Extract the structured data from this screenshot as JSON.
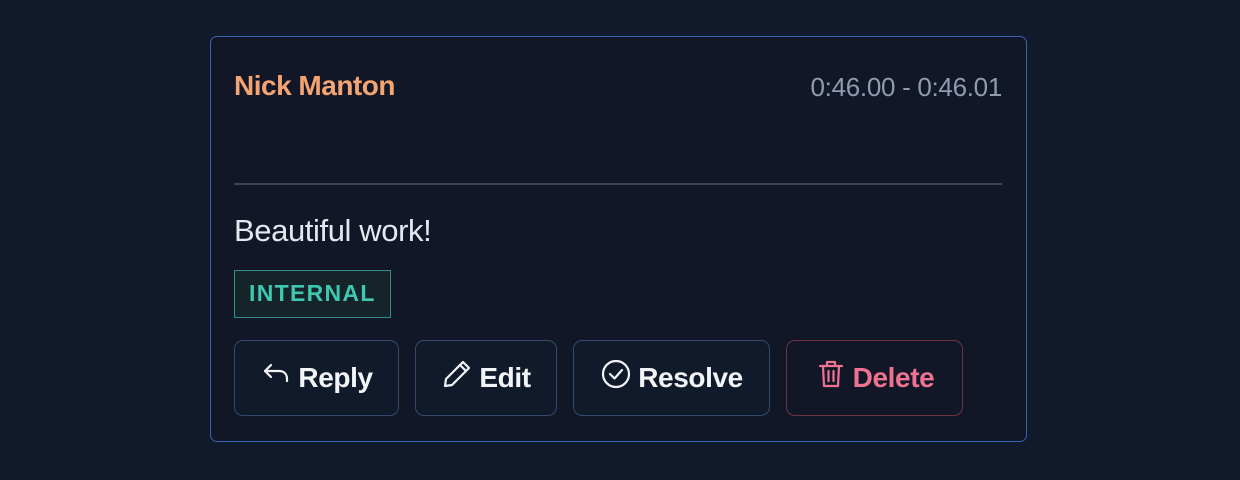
{
  "comment": {
    "author": "Nick Manton",
    "timestamp": "0:46.00 - 0:46.01",
    "body": "Beautiful work!",
    "badge": "INTERNAL"
  },
  "actions": {
    "reply_label": "Reply",
    "edit_label": "Edit",
    "resolve_label": "Resolve",
    "delete_label": "Delete"
  },
  "icons": {
    "reply": "reply-arrow-icon",
    "edit": "pencil-icon",
    "resolve": "check-circle-icon",
    "delete": "trash-icon"
  },
  "colors": {
    "author": "#f4a372",
    "badge": "#3fc7b1",
    "delete": "#f07292",
    "card_border": "#3563b0"
  }
}
